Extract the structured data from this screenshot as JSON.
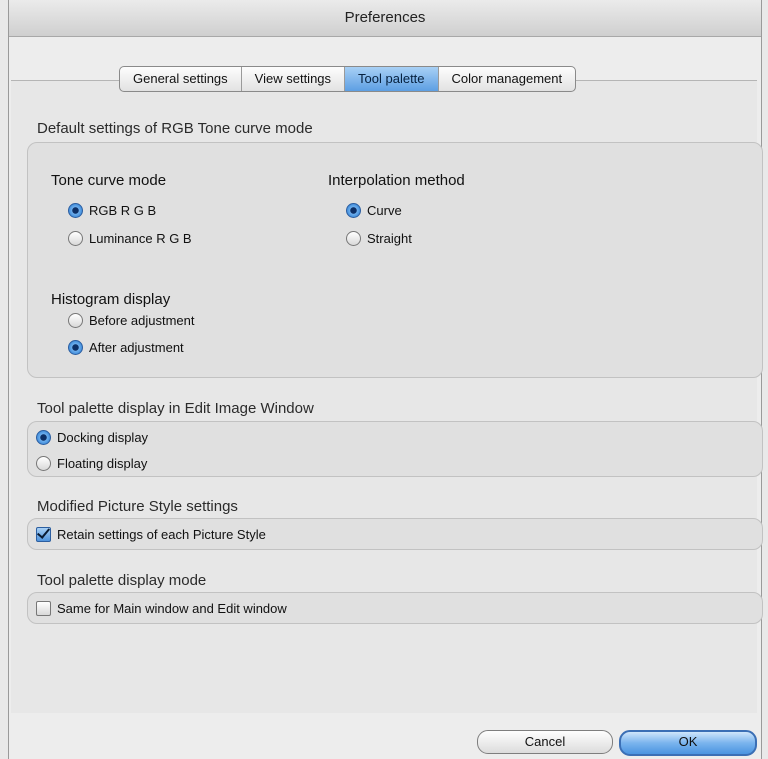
{
  "window": {
    "title": "Preferences"
  },
  "tabs": [
    {
      "label": "General settings",
      "active": false
    },
    {
      "label": "View settings",
      "active": false
    },
    {
      "label": "Tool palette",
      "active": true
    },
    {
      "label": "Color management",
      "active": false
    }
  ],
  "tone_curve_defaults": {
    "title": "Default settings of RGB Tone curve mode",
    "tone_curve_mode": {
      "title": "Tone curve mode",
      "options": [
        "RGB R G B",
        "Luminance R G B"
      ],
      "selected": "RGB R G B"
    },
    "interpolation": {
      "title": "Interpolation method",
      "options": [
        "Curve",
        "Straight"
      ],
      "selected": "Curve"
    },
    "histogram": {
      "title": "Histogram display",
      "options": [
        "Before adjustment",
        "After adjustment"
      ],
      "selected": "After adjustment"
    }
  },
  "palette_display": {
    "title": "Tool palette display in Edit Image Window",
    "options": [
      "Docking display",
      "Floating display"
    ],
    "selected": "Docking display"
  },
  "picture_style": {
    "title": "Modified Picture Style settings",
    "checkbox_label": "Retain settings of each Picture Style",
    "checked": true
  },
  "palette_mode": {
    "title": "Tool palette display mode",
    "checkbox_label": "Same for Main window and Edit window",
    "checked": false
  },
  "buttons": {
    "cancel": "Cancel",
    "ok": "OK"
  },
  "colors": {
    "accent": "#5d9fe3"
  }
}
